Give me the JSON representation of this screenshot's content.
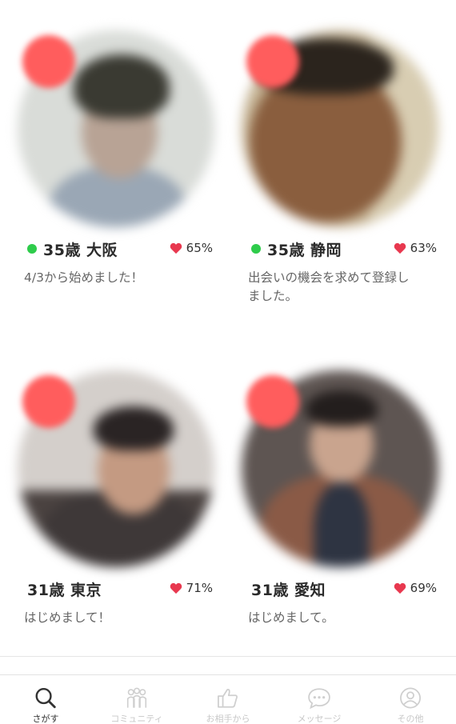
{
  "profiles": [
    {
      "age_area": "35歳 大阪",
      "online": true,
      "match": "65%",
      "message": "4/3から始めました！"
    },
    {
      "age_area": "35歳 静岡",
      "online": true,
      "match": "63%",
      "message": "出会いの機会を求めて登録し\nました。"
    },
    {
      "age_area": "31歳 東京",
      "online": false,
      "match": "71%",
      "message": "はじめまして！"
    },
    {
      "age_area": "31歳 愛知",
      "online": false,
      "match": "69%",
      "message": "はじめまして。"
    }
  ],
  "tabs": [
    {
      "label": "さがす",
      "icon": "search-icon",
      "active": true
    },
    {
      "label": "コミュニティ",
      "icon": "people-icon",
      "active": false
    },
    {
      "label": "お相手から",
      "icon": "thumbs-up-icon",
      "active": false
    },
    {
      "label": "メッセージ",
      "icon": "chat-bubble-icon",
      "active": false
    },
    {
      "label": "その他",
      "icon": "user-icon",
      "active": false
    }
  ],
  "colors": {
    "badge": "#ff5d5d",
    "online": "#2ecc4b",
    "heart": "#e8384f"
  }
}
